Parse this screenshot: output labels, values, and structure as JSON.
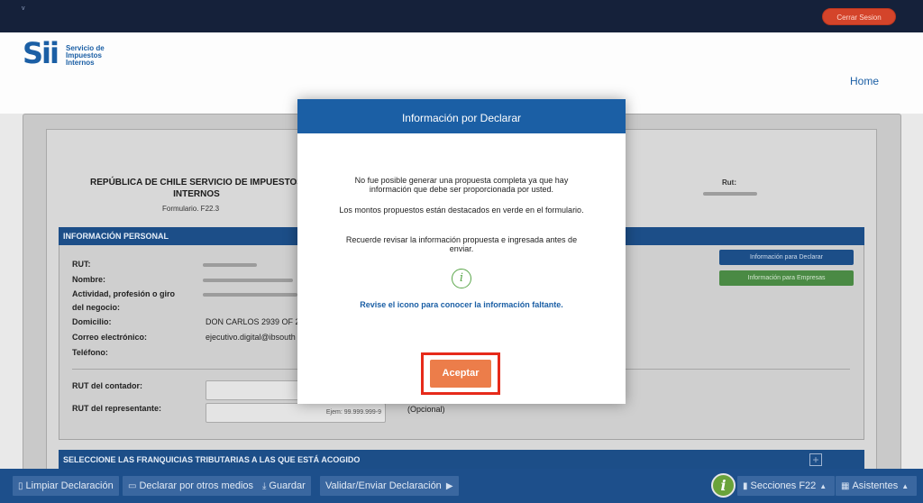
{
  "topbar": {
    "mark": "v",
    "logout_label": "Cerrar Sesion"
  },
  "header": {
    "logo_glyph": "Sii",
    "logo_line1": "Servicio de",
    "logo_line2": "Impuestos",
    "logo_line3": "Internos",
    "home_label": "Home"
  },
  "form": {
    "title_line1": "REPÚBLICA DE CHILE SERVICIO DE IMPUESTOS",
    "title_line2": "INTERNOS",
    "form_code": "Formulario. F22.3",
    "rut_head": "Rut:"
  },
  "personal": {
    "header": "INFORMACIÓN PERSONAL",
    "labels": {
      "rut": "RUT:",
      "nombre": "Nombre:",
      "actividad_1": "Actividad, profesión o giro",
      "actividad_2": "del negocio:",
      "domicilio": "Domicilio:",
      "correo": "Correo electrónico:",
      "telefono": "Teléfono:",
      "rut_contador": "RUT del contador:",
      "rut_representante": "RUT del representante:"
    },
    "values": {
      "domicilio": "DON CARLOS 2939 OF 2",
      "correo": "ejecutivo.digital@ibsouth",
      "representante_placeholder": "Ejem: 99.999.999-9",
      "opcional": "(Opcional)"
    },
    "btn_info_declarar": "Información para Declarar",
    "btn_info_empresas": "Información para Empresas"
  },
  "franquicias": {
    "header": "SELECCIONE LAS FRANQUICIAS TRIBUTARIAS A LAS QUE ESTÁ ACOGIDO",
    "toggle": "+"
  },
  "bottombar": {
    "limpiar": "Limpiar Declaración",
    "declarar_otros": "Declarar por otros medios",
    "guardar": "Guardar",
    "validar": "Validar/Enviar Declaración",
    "info_glyph": "i",
    "secciones": "Secciones F22",
    "asistentes": "Asistentes"
  },
  "modal": {
    "title": "Información por Declarar",
    "p1": "No fue posible generar una propuesta completa ya que hay información que debe ser proporcionada por usted.",
    "p2": "Los montos propuestos están destacados en verde en el formulario.",
    "p3": "Recuerde revisar la información propuesta e ingresada antes de enviar.",
    "icon_glyph": "i",
    "hint": "Revise el icono para conocer la información faltante.",
    "accept_label": "Aceptar"
  },
  "colors": {
    "brand_blue": "#1b5fa5",
    "accent_orange": "#ec7d4a",
    "highlight_red": "#e62a1a",
    "success_green": "#5aa64a"
  }
}
